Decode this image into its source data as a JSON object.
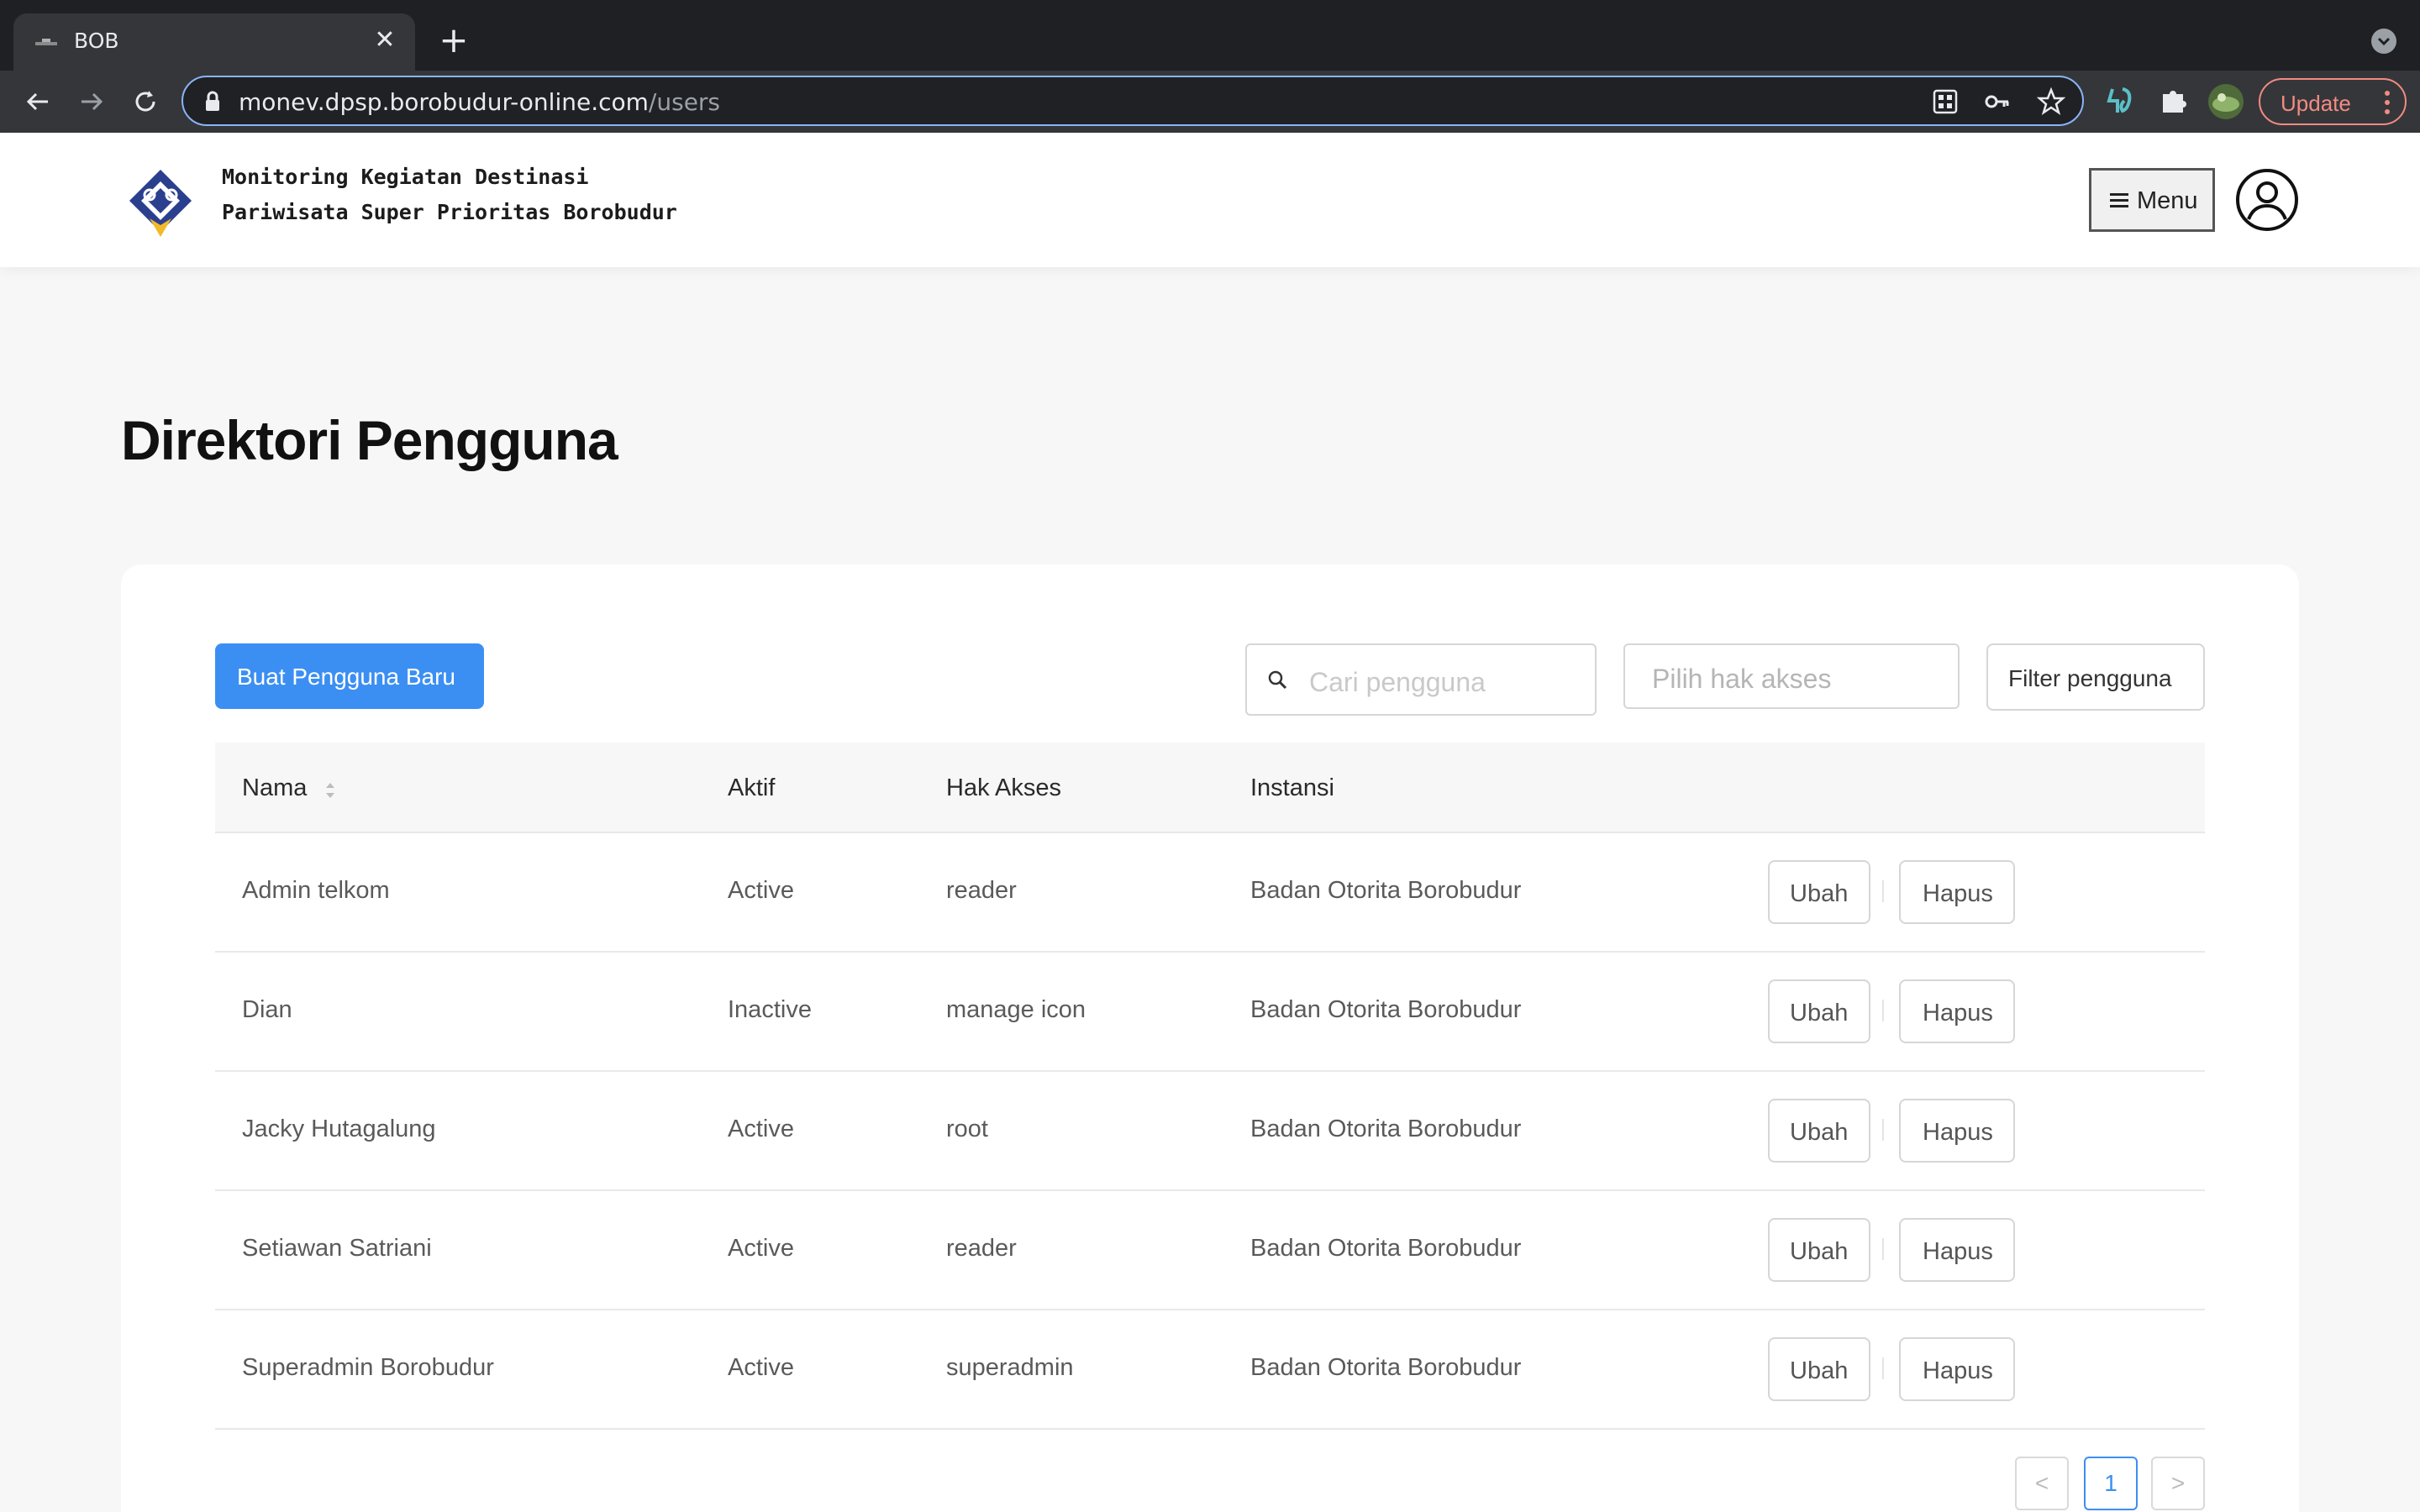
{
  "browser": {
    "tab_title": "BOB",
    "tab_close": "✕",
    "new_tab": "+",
    "url_host": "monev.dpsp.borobudur-online.com",
    "url_path": "/users",
    "update_label": "Update",
    "icons": [
      "back-icon",
      "forward-icon",
      "reload-icon",
      "lock-icon",
      "qr-code-icon",
      "key-icon",
      "star-icon",
      "extension-icon",
      "puzzle-icon",
      "profile-avatar-icon",
      "more-vert-icon"
    ]
  },
  "header": {
    "title_line1": "Monitoring Kegiatan Destinasi",
    "title_line2": "Pariwisata Super Prioritas Borobudur",
    "menu_label": "Menu"
  },
  "page": {
    "title": "Direktori Pengguna"
  },
  "toolbar": {
    "create_label": "Buat Pengguna Baru",
    "search_placeholder": "Cari pengguna",
    "role_placeholder": "Pilih hak akses",
    "filter_label": "Filter pengguna"
  },
  "table": {
    "columns": [
      "Nama",
      "Aktif",
      "Hak Akses",
      "Instansi"
    ],
    "rows": [
      {
        "nama": "Admin telkom",
        "aktif": "Active",
        "hak": "reader",
        "instansi": "Badan Otorita Borobudur"
      },
      {
        "nama": "Dian",
        "aktif": "Inactive",
        "hak": "manage icon",
        "instansi": "Badan Otorita Borobudur"
      },
      {
        "nama": "Jacky Hutagalung",
        "aktif": "Active",
        "hak": "root",
        "instansi": "Badan Otorita Borobudur"
      },
      {
        "nama": "Setiawan Satriani",
        "aktif": "Active",
        "hak": "reader",
        "instansi": "Badan Otorita Borobudur"
      },
      {
        "nama": "Superadmin Borobudur",
        "aktif": "Active",
        "hak": "superadmin",
        "instansi": "Badan Otorita Borobudur"
      }
    ],
    "edit_label": "Ubah",
    "delete_label": "Hapus"
  },
  "pagination": {
    "prev": "<",
    "current": "1",
    "next": ">"
  },
  "colors": {
    "primary": "#3b8ff3",
    "update_accent": "#f28b82",
    "omnibox_focus": "#8ab4f8"
  }
}
